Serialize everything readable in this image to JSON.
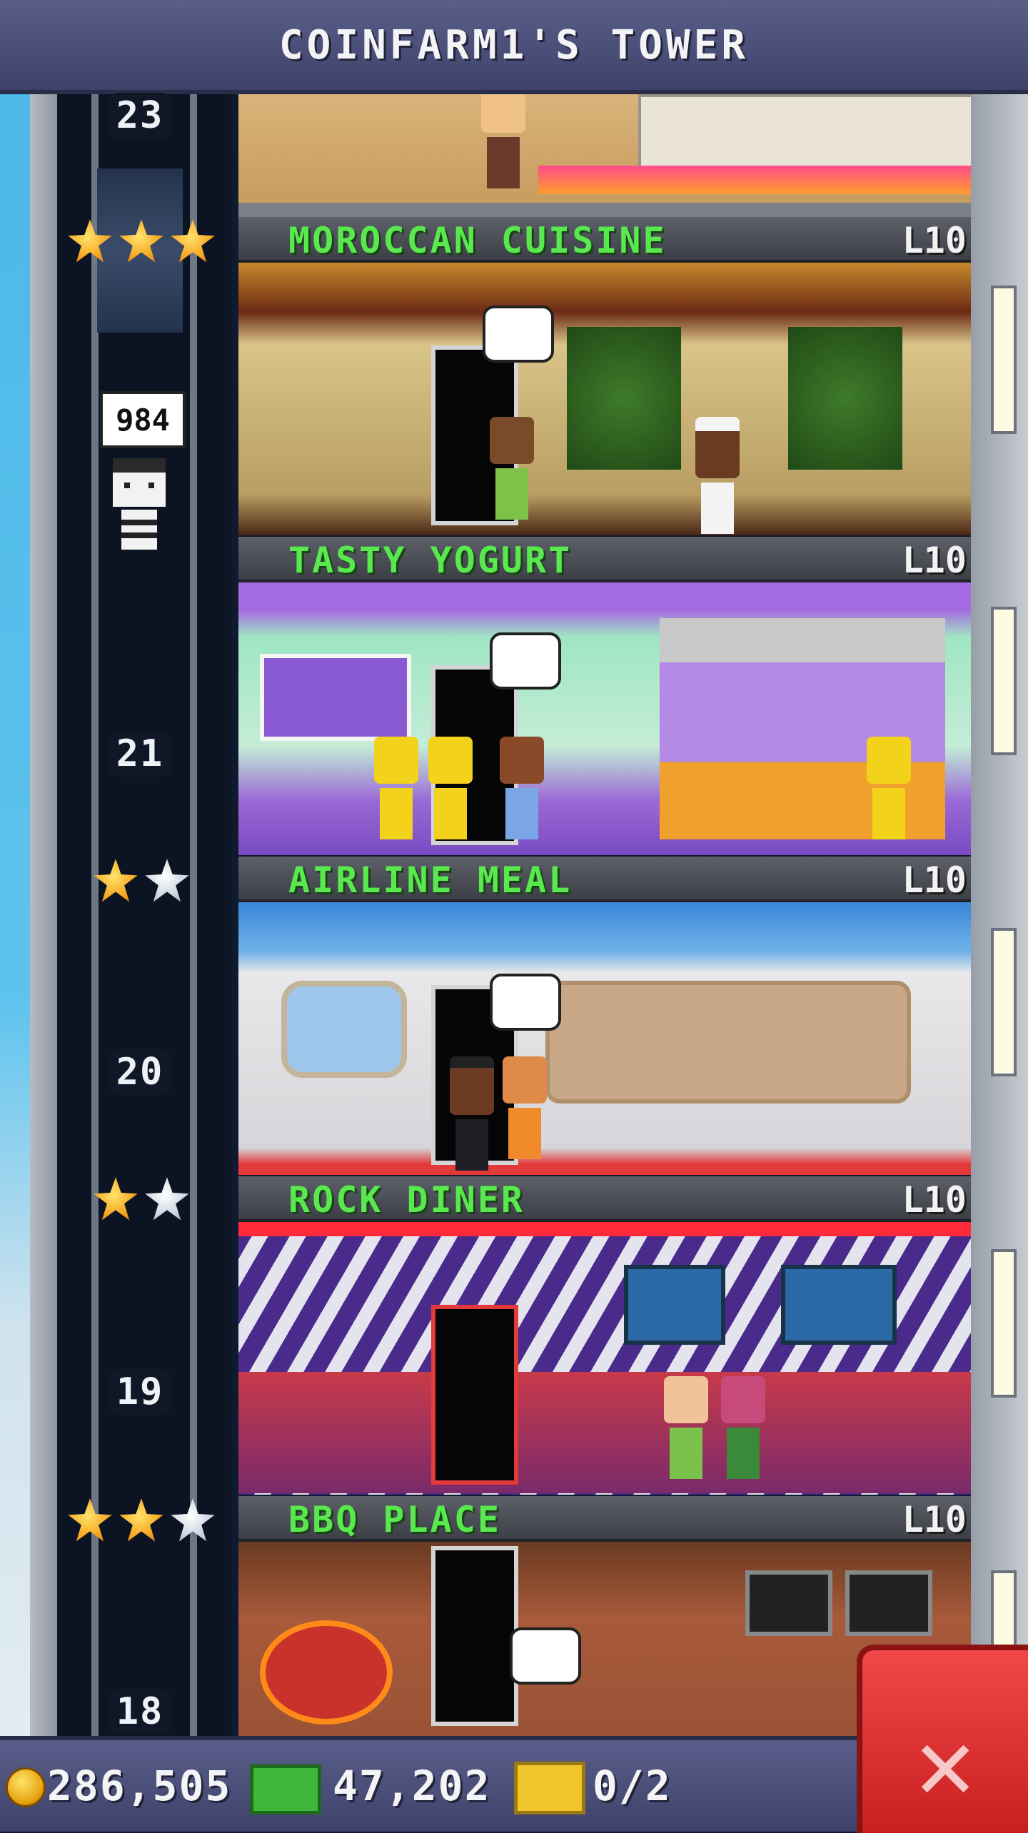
{
  "header": {
    "title": "COINFARM1'S TOWER"
  },
  "elevator": {
    "floor_numbers": [
      "23",
      "21",
      "20",
      "19",
      "18"
    ],
    "bitizen_bubble": "984"
  },
  "floors": [
    {
      "name": "MOROCCAN CUISINE",
      "level": "L10",
      "stars_gold": 3,
      "stars_total": 3
    },
    {
      "name": "TASTY YOGURT",
      "level": "L10",
      "stars_gold": 0,
      "stars_total": 0
    },
    {
      "name": "AIRLINE MEAL",
      "level": "L10",
      "stars_gold": 1,
      "stars_total": 2
    },
    {
      "name": "ROCK DINER",
      "level": "L10",
      "stars_gold": 1,
      "stars_total": 2
    },
    {
      "name": "BBQ PLACE",
      "level": "L10",
      "stars_gold": 2,
      "stars_total": 3
    }
  ],
  "resources": {
    "coins": "286,505",
    "bux": "47,202",
    "tickets": "0/2"
  },
  "colors": {
    "floor_name": "#59e94f",
    "accent_close": "#d92c2c"
  },
  "icons": {
    "coin": "coin-icon",
    "bux": "bux-icon",
    "ticket": "ticket-icon",
    "close": "close-icon",
    "star_gold": "gold-star-icon",
    "star_silver": "silver-star-icon"
  }
}
